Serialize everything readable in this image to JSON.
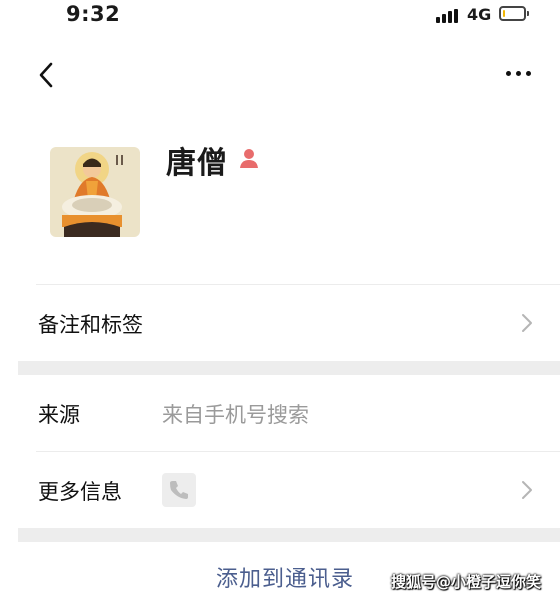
{
  "status_bar": {
    "time": "9:32",
    "network": "4G",
    "battery_level_percent": 10,
    "battery_color": "#f2b705"
  },
  "nav": {
    "back_icon": "chevron-left-icon",
    "more_icon": "more-dots-icon"
  },
  "profile": {
    "name": "唐僧",
    "gender_icon": "person-icon",
    "gender_icon_color": "#e86c6c",
    "avatar": "buddha-painting"
  },
  "rows": {
    "remark_label": "备注和标签",
    "source_label": "来源",
    "source_value": "来自手机号搜索",
    "more_info_label": "更多信息",
    "more_info_icon": "phone-icon"
  },
  "actions": {
    "add_contact": "添加到通讯录"
  },
  "watermark": {
    "text": "搜狐号@小橙子逗你笑"
  },
  "colors": {
    "link": "#4b5e8e",
    "muted_text": "#9a9a9a",
    "section_gap": "#ededed"
  }
}
